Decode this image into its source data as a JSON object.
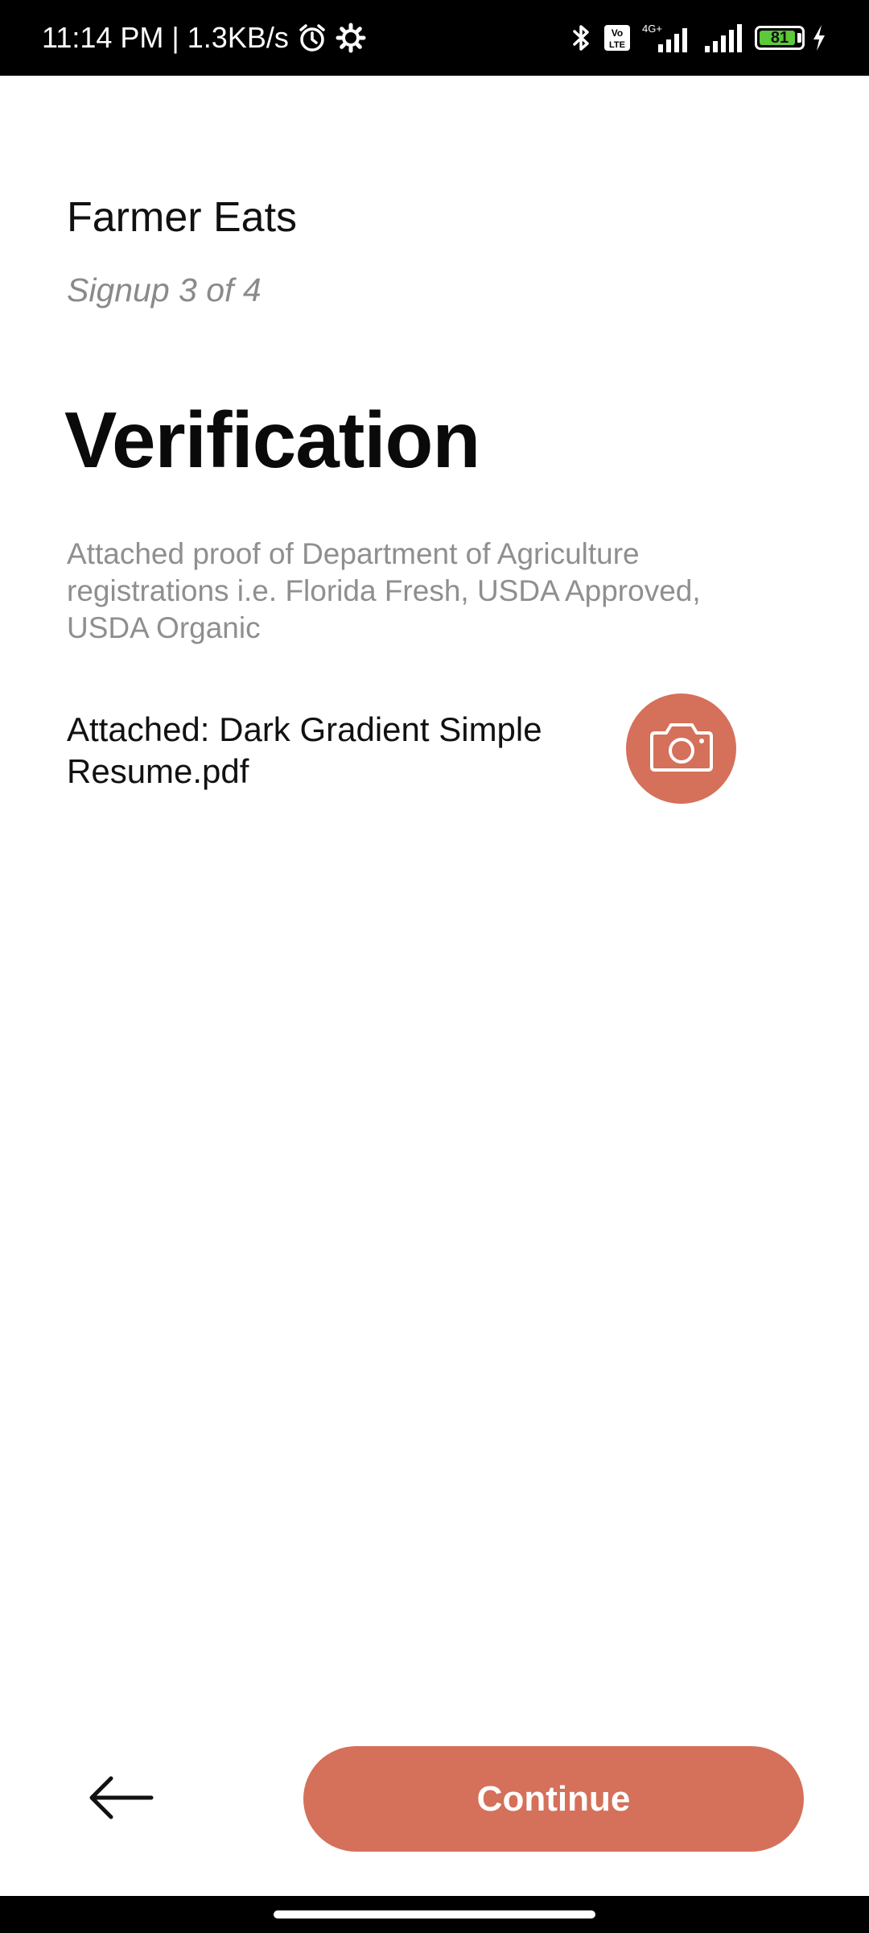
{
  "status_bar": {
    "time": "11:14 PM",
    "separator": "|",
    "speed": "1.3KB/s",
    "battery_level": "81",
    "network_label": "4G+",
    "volte_label": "Vo LTE",
    "icons": [
      "alarm-icon",
      "settings-icon",
      "bluetooth-icon",
      "volte-icon",
      "signal-icon",
      "signal-icon",
      "battery-icon",
      "charging-icon"
    ]
  },
  "header": {
    "app_name": "Farmer Eats",
    "step": "Signup 3 of 4"
  },
  "main": {
    "title": "Verification",
    "description": "Attached proof of Department of Agriculture registrations i.e. Florida Fresh, USDA Approved, USDA Organic",
    "attachment": "Attached: Dark Gradient Simple Resume.pdf",
    "camera_icon": "camera-icon"
  },
  "footer": {
    "back_icon": "arrow-left-icon",
    "continue_label": "Continue"
  },
  "colors": {
    "accent": "#d5705a",
    "text_primary": "#111111",
    "text_secondary": "#8f8f8f",
    "status_bar_bg": "#000000",
    "battery": "#5cc83a"
  }
}
